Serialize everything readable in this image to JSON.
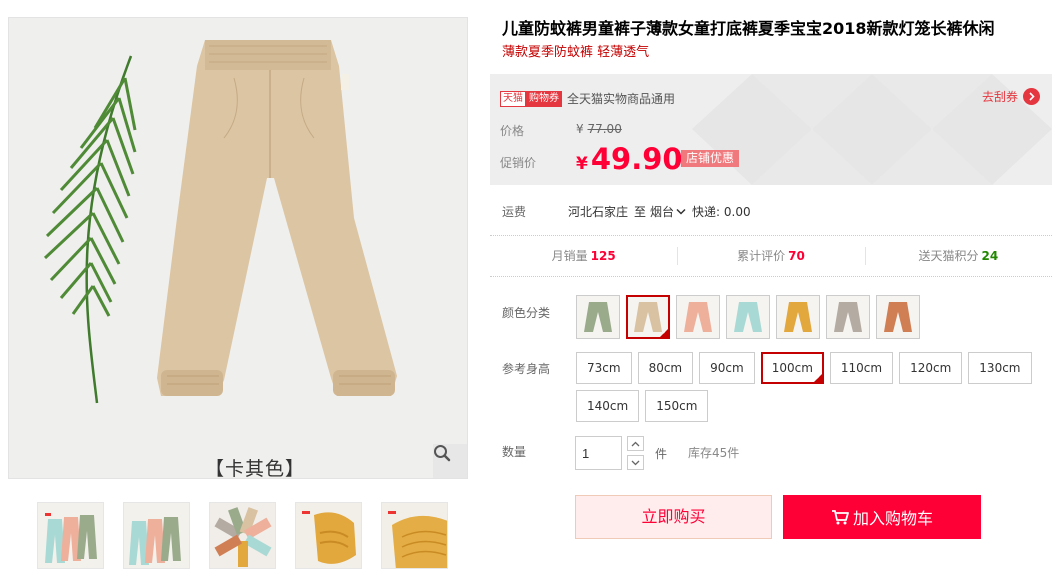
{
  "gallery": {
    "caption": "【卡其色】",
    "zoom_icon": "magnifier-icon",
    "thumbnails": [
      {
        "name": "thumb-three-pants"
      },
      {
        "name": "thumb-three-pants-2"
      },
      {
        "name": "thumb-fan-of-colors"
      },
      {
        "name": "thumb-cuff-detail"
      },
      {
        "name": "thumb-fabric-detail"
      }
    ]
  },
  "product": {
    "title": "儿童防蚊裤男童裤子薄款女童打底裤夏季宝宝2018新款灯笼长裤休闲",
    "subtitle": "薄款夏季防蚊裤 轻薄透气"
  },
  "price": {
    "coupon_tag_a": "天猫",
    "coupon_tag_b": "购物券",
    "coupon_text": "全天猫实物商品通用",
    "get_coupon": "去刮券",
    "price_label": "价格",
    "currency": "¥",
    "original": "77.00",
    "promo_label": "促销价",
    "promo_value": "49.90",
    "promo_tag": "店铺优惠",
    "accent": "#ff0036"
  },
  "shipping": {
    "label": "运费",
    "origin": "河北石家庄",
    "to": "至",
    "destination": "烟台",
    "express": "快递: 0.00"
  },
  "stats": [
    {
      "label": "月销量",
      "value": "125",
      "color": "red"
    },
    {
      "label": "累计评价",
      "value": "70",
      "color": "red"
    },
    {
      "label": "送天猫积分",
      "value": "24",
      "color": "green"
    }
  ],
  "sku": {
    "color_label": "颜色分类",
    "colors": [
      {
        "name": "green",
        "color": "#9aab8c",
        "selected": false
      },
      {
        "name": "khaki",
        "color": "#d9c2a2",
        "selected": true
      },
      {
        "name": "pink",
        "color": "#eeaf9b",
        "selected": false
      },
      {
        "name": "aqua",
        "color": "#a9d9d4",
        "selected": false
      },
      {
        "name": "mustard",
        "color": "#e2a73d",
        "selected": false
      },
      {
        "name": "gray",
        "color": "#b4aba2",
        "selected": false
      },
      {
        "name": "rust",
        "color": "#d07f55",
        "selected": false
      }
    ],
    "size_label": "参考身高",
    "sizes": [
      "73cm",
      "80cm",
      "90cm",
      "100cm",
      "110cm",
      "120cm",
      "130cm",
      "140cm",
      "150cm"
    ],
    "selected_size": "100cm"
  },
  "quantity": {
    "label": "数量",
    "value": "1",
    "unit": "件",
    "stock": "库存45件"
  },
  "actions": {
    "buy_now": "立即购买",
    "add_cart": "加入购物车"
  }
}
